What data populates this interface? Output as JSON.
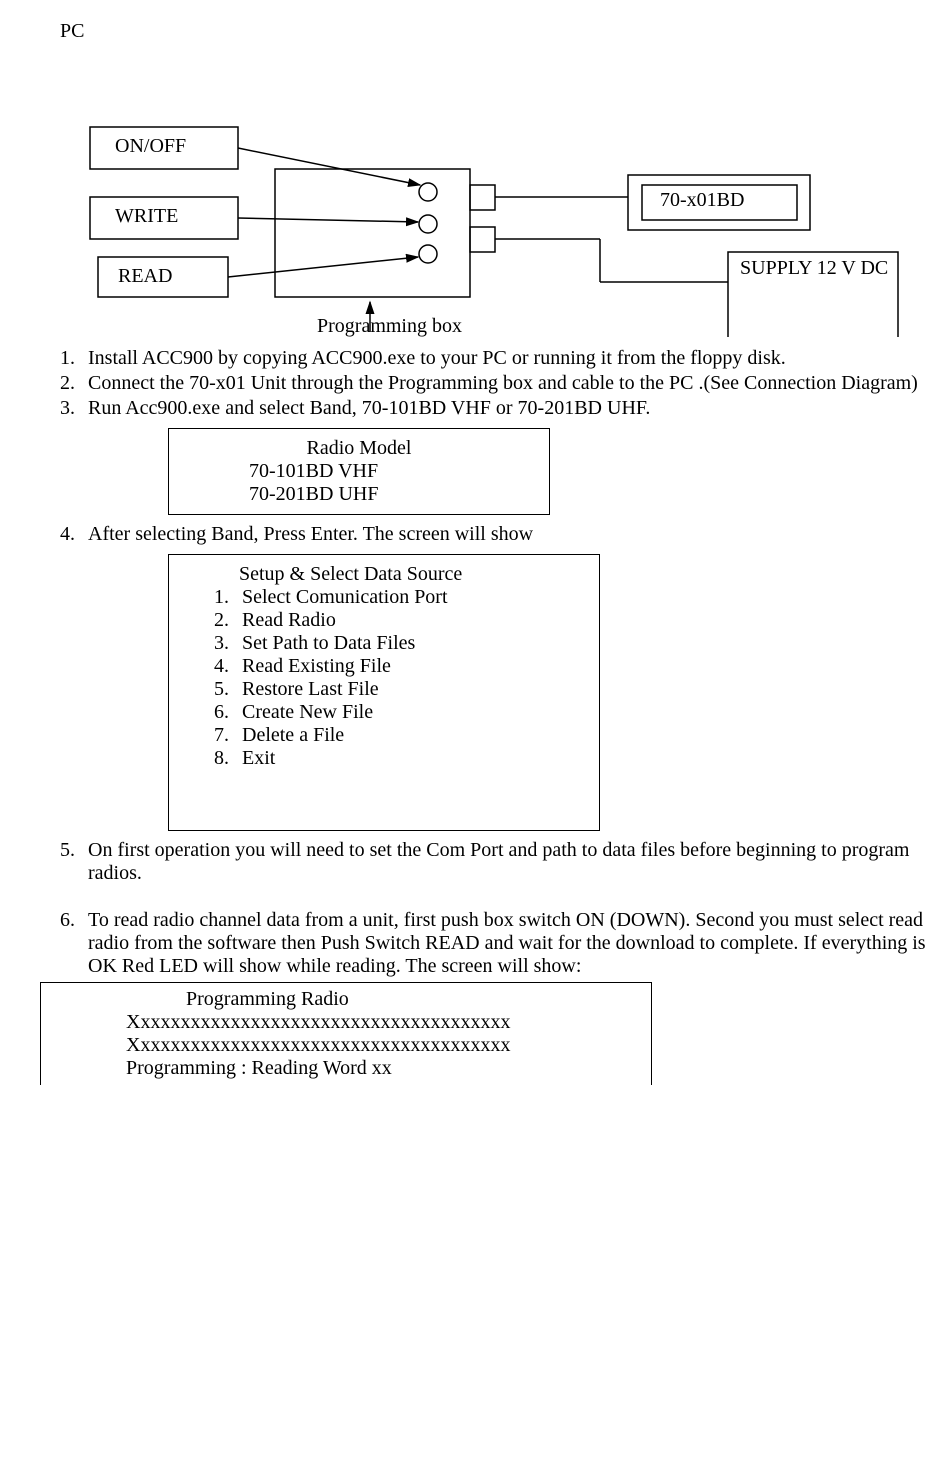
{
  "labels": {
    "pc": "PC",
    "on_off": "ON/OFF",
    "write": "WRITE",
    "read": "READ",
    "prog_box_caption": "Programming box",
    "device": "70-x01BD",
    "supply": "SUPPLY 12 V DC"
  },
  "steps": {
    "s1": "Install ACC900 by copying ACC900.exe to your PC or running it from the floppy disk.",
    "s2": "Connect the 70-x01 Unit through the Programming box and cable to the  PC .(See Connection Diagram)",
    "s3": "Run Acc900.exe and select Band, 70-101BD VHF or 70-201BD UHF.",
    "s4": "After selecting Band, Press Enter.  The screen will show",
    "s5": "On first operation you will need to set the Com Port and path to data files before beginning to program radios.",
    "s6": " To read radio channel data from a unit, first push box switch ON (DOWN). Second you must select read radio from the software then Push Switch READ and wait for the download to complete. If everything is OK Red LED will show while reading.  The screen will show:"
  },
  "radio_model": {
    "title": "Radio Model",
    "opt1": "70-101BD VHF",
    "opt2": "70-201BD UHF"
  },
  "setup": {
    "title": "Setup & Select Data Source",
    "items": {
      "i1": "Select Comunication Port",
      "i2": "Read Radio",
      "i3": "Set Path to Data Files",
      "i4": "Read Existing File",
      "i5": "Restore Last File",
      "i6": "Create New File",
      "i7": "Delete a File",
      "i8": "Exit"
    }
  },
  "programming": {
    "title": "Programming Radio",
    "line1": "Xxxxxxxxxxxxxxxxxxxxxxxxxxxxxxxxxxxxxx",
    "line2": "Xxxxxxxxxxxxxxxxxxxxxxxxxxxxxxxxxxxxxx",
    "line3": "Programming : Reading  Word xx"
  }
}
